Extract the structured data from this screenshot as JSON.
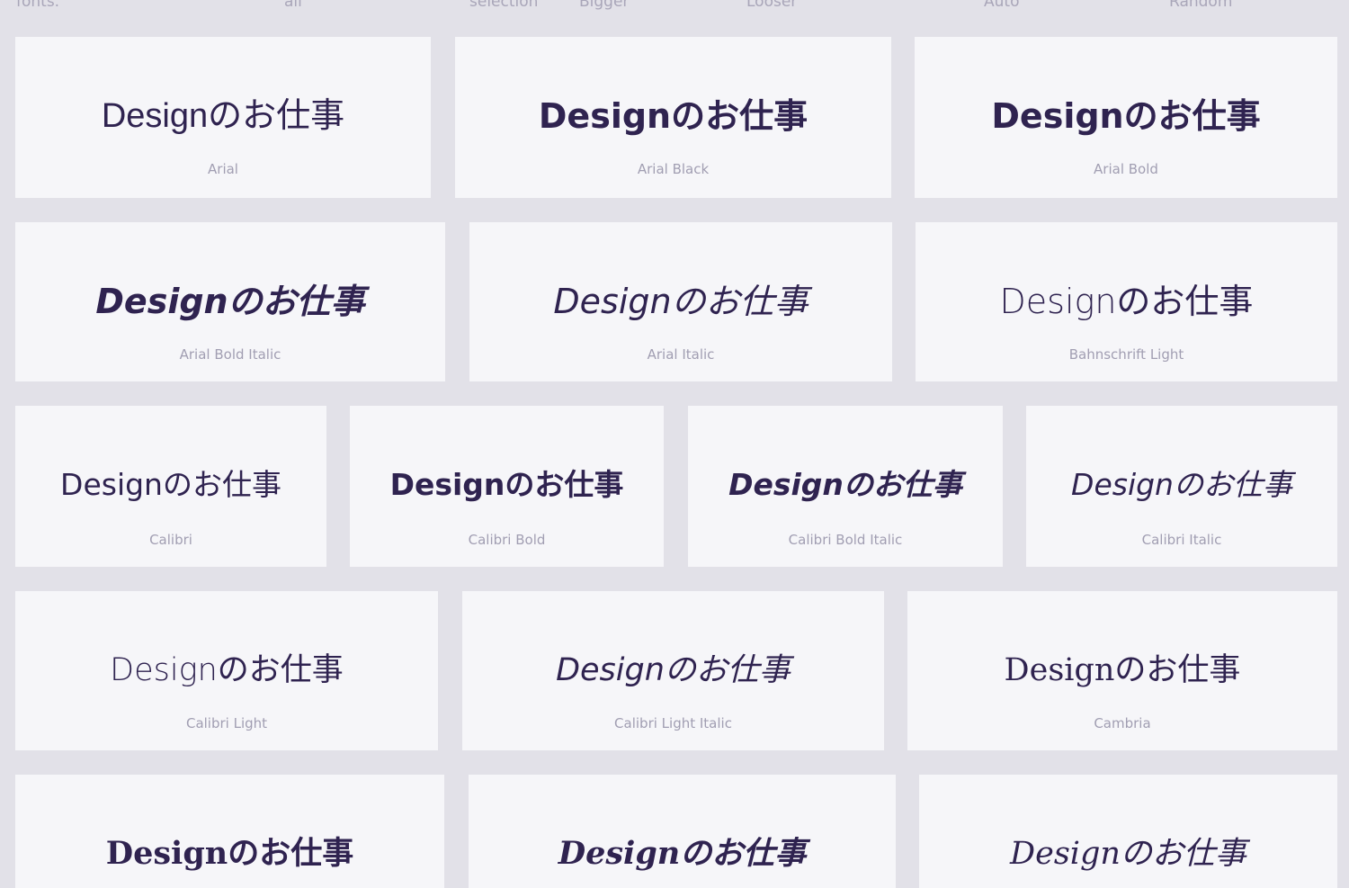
{
  "toolbar": {
    "fonts_label": "fonts.",
    "all_label": "all",
    "selection_label": "selection",
    "bigger_label": "Bigger",
    "looser_label": "Looser",
    "auto_label": "Auto",
    "random_label": "Random"
  },
  "sample_text": "Designのお仕事",
  "cards": [
    {
      "font_name": "Arial"
    },
    {
      "font_name": "Arial Black"
    },
    {
      "font_name": "Arial Bold"
    },
    {
      "font_name": "Arial Bold Italic"
    },
    {
      "font_name": "Arial Italic"
    },
    {
      "font_name": "Bahnschrift Light"
    },
    {
      "font_name": "Calibri"
    },
    {
      "font_name": "Calibri Bold"
    },
    {
      "font_name": "Calibri Bold Italic"
    },
    {
      "font_name": "Calibri Italic"
    },
    {
      "font_name": "Calibri Light"
    },
    {
      "font_name": "Calibri Light Italic"
    },
    {
      "font_name": "Cambria"
    },
    {
      "font_name": ""
    },
    {
      "font_name": ""
    },
    {
      "font_name": ""
    }
  ],
  "colors": {
    "background": "#e2e1e8",
    "card": "#f6f6f9",
    "sample_text": "#2f2350",
    "font_name": "#a19eb2",
    "toolbar_text": "#a9a6b9"
  }
}
